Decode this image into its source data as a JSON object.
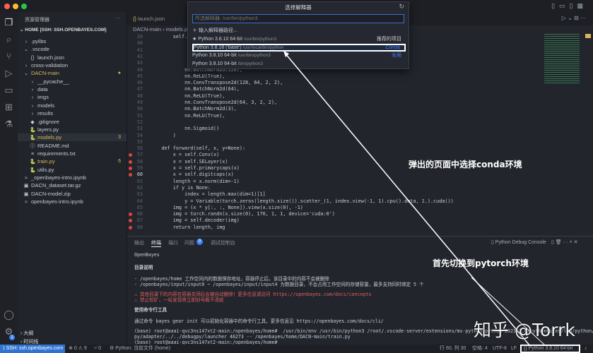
{
  "popup": {
    "title": "选择解释器",
    "placeholder": "所选解释器: /usr/bin/python3",
    "enter_path": "输入解释器路径...",
    "items": [
      {
        "name": "Python 3.8.10 64-bit",
        "path": "/usr/bin/python3",
        "tag": "推荐的项目",
        "star": "★"
      },
      {
        "name": "Python 3.8.18 ('base')",
        "path": "/usr/local/bin/python",
        "tag": "Conda"
      },
      {
        "name": "Python 3.8.10 64-bit",
        "path": "/usr/bin/python3",
        "tag": "全局"
      },
      {
        "name": "Python 3.8.10 64-bit",
        "path": "/bin/python3",
        "tag": ""
      }
    ]
  },
  "sidebar": {
    "title": "资源管理器",
    "root": "HOME [SSH: SSH.OPENBAYES.COM]",
    "items": [
      {
        "label": ".pylibs",
        "icon": "›",
        "depth": 0
      },
      {
        "label": ".vscode",
        "icon": "⌄",
        "depth": 0
      },
      {
        "label": "launch.json",
        "icon": "{}",
        "depth": 1
      },
      {
        "label": "cross-validation",
        "icon": "›",
        "depth": 0
      },
      {
        "label": "DACN-main",
        "icon": "⌄",
        "depth": 0,
        "mod": true,
        "badge": "●"
      },
      {
        "label": "__pycache__",
        "icon": "›",
        "depth": 1
      },
      {
        "label": "data",
        "icon": "›",
        "depth": 1
      },
      {
        "label": "imgs",
        "icon": "›",
        "depth": 1
      },
      {
        "label": "models",
        "icon": "›",
        "depth": 1
      },
      {
        "label": "results",
        "icon": "›",
        "depth": 1
      },
      {
        "label": ".gitignore",
        "icon": "◆",
        "depth": 1
      },
      {
        "label": "layers.py",
        "icon": "🐍",
        "depth": 1
      },
      {
        "label": "models.py",
        "icon": "🐍",
        "depth": 1,
        "mod": true,
        "badge": "3"
      },
      {
        "label": "README.md",
        "icon": "ⓘ",
        "depth": 1
      },
      {
        "label": "requirements.txt",
        "icon": "≡",
        "depth": 1
      },
      {
        "label": "train.py",
        "icon": "🐍",
        "depth": 1,
        "mod": true,
        "badge": "6"
      },
      {
        "label": "utils.py",
        "icon": "🐍",
        "depth": 1
      },
      {
        "label": "_openbayes-intro.ipynb",
        "icon": "≈",
        "depth": 0
      },
      {
        "label": "DACN_dataset.tar.gz",
        "icon": "▣",
        "depth": 0
      },
      {
        "label": "DACN-model.zip",
        "icon": "▣",
        "depth": 0
      },
      {
        "label": "openbayes-intro.ipynb",
        "icon": "≈",
        "depth": 0
      }
    ],
    "outline": "大纲",
    "timeline": "时间线"
  },
  "editor": {
    "tab": "launch.json",
    "breadcrumb": [
      "DACN-main",
      "models.py"
    ],
    "lines": [
      {
        "n": "39",
        "t": "        self.c"
      },
      {
        "n": "40",
        "t": ""
      },
      {
        "n": "41",
        "t": ""
      },
      {
        "n": "42",
        "t": ""
      },
      {
        "n": "43",
        "t": ""
      },
      {
        "n": "44",
        "t": "            nn.BatchNorm2d(128),"
      },
      {
        "n": "45",
        "t": "            nn.ReLU(True),"
      },
      {
        "n": "46",
        "t": "            nn.ConvTranspose2d(128, 64, 2, 2),"
      },
      {
        "n": "47",
        "t": "            nn.BatchNorm2d(64),"
      },
      {
        "n": "48",
        "t": "            nn.ReLU(True),"
      },
      {
        "n": "49",
        "t": "            nn.ConvTranspose2d(64, 3, 2, 2),"
      },
      {
        "n": "50",
        "t": "            nn.BatchNorm2d(3),"
      },
      {
        "n": "51",
        "t": "            nn.ReLU(True),"
      },
      {
        "n": "52",
        "t": ""
      },
      {
        "n": "53",
        "t": "            nn.Sigmoid()"
      },
      {
        "n": "54",
        "t": "        )"
      },
      {
        "n": "55",
        "t": ""
      },
      {
        "n": "56",
        "t": "    def forward(self, x, y=None):"
      },
      {
        "n": "57",
        "t": "        x = self.Conv(x)",
        "bp": true
      },
      {
        "n": "58",
        "t": "        x = self.SELayer(x)",
        "bp": true
      },
      {
        "n": "59",
        "t": "        x = self.primarycaps(x)",
        "bp": true
      },
      {
        "n": "60",
        "t": "        x = self.digitcaps(x)",
        "bp": true
      },
      {
        "n": "61",
        "t": "        length = x.norm(dim=-1)"
      },
      {
        "n": "62",
        "t": "        if y is None:"
      },
      {
        "n": "63",
        "t": "            index = length.max(dim=1)[1]"
      },
      {
        "n": "64",
        "t": "            y = Variable(torch.zeros(length.size()).scatter_(1, index.view(-1, 1).cpu().data, 1.).cuda())"
      },
      {
        "n": "65",
        "t": "        img = (x * y[:, :, None]).view(x.size(0), -1)"
      },
      {
        "n": "66",
        "t": "        img = torch.randn(x.size(0), 176, 1, 1, device='cuda:0')",
        "bp": true
      },
      {
        "n": "67",
        "t": "        img = self.decoder(img)",
        "bp": true
      },
      {
        "n": "68",
        "t": "        return length, img",
        "bp": true
      }
    ]
  },
  "panel": {
    "tabs": [
      "输出",
      "终端",
      "端口",
      "问题",
      "调试控制台"
    ],
    "problems_count": "9",
    "console_name": "Python Debug Console",
    "terminal": [
      {
        "t": "OpenBayes",
        "c": ""
      },
      {
        "t": "目录说明",
        "c": "b"
      },
      {
        "t": "- /openbayes/home 工作空间内的数据保存地址，容器停止后，该目录中的内容不会被删除",
        "c": ""
      },
      {
        "t": "- /openbayes/input/input0 ~ /openbayes/input/input4 为数据目录，不会占用工作空间的存储容量，最多支持同时绑定 5 个",
        "c": ""
      },
      {
        "t": "⚠ 其他目录下的内容在容器关闭后会被自动删除！更多信息请访问 https://openbayes.com/docs/concepts",
        "c": "r"
      },
      {
        "t": "⚠ 禁止挖矿，一经发现将立即封号概不退款",
        "c": "r"
      },
      {
        "t": "使用命令行工具",
        "c": "b"
      },
      {
        "t": "通过命令 bayes gear init 可以初始化容器中的命令行工具，更多信息见 https://openbayes.com/docs/cli/",
        "c": ""
      },
      {
        "t": "(base) root@aaai-qvc3ns147xt2-main:/openbayes/home#  /usr/bin/env /usr/bin/python3 /root/.vscode-server/extensions/ms-python.python-2023.2.0/pythonFiles/lib/python/debug",
        "c": ""
      },
      {
        "t": "py/adapter/../../debugpy/launcher 46273 -- /openbayes/home/DACN-main/train.py",
        "c": ""
      },
      {
        "t": "(base) root@aaai-qvc3ns147xt2-main:/openbayes/home#",
        "c": ""
      }
    ]
  },
  "status": {
    "remote": "SSH: ssh.openbayes.com",
    "errors": "0",
    "warnings": "9",
    "ports": "0",
    "python_file": "Python: 当前文件 (home)",
    "position": "行 60, 列 30",
    "spaces": "空格: 4",
    "encoding": "UTF-8",
    "eol": "LF",
    "interpreter": "Python",
    "interpreter_version": "3.8.10 64-bit",
    "settings_badge": "1"
  },
  "annotations": {
    "select_conda": "弹出的页面中选择conda环境",
    "switch_env": "首先切换到pytorch环境",
    "watermark": "知乎 @Torrk"
  },
  "colors": {
    "accent": "#3b82f6",
    "status_remote": "#2f74d0",
    "breakpoint": "#e0443e"
  }
}
